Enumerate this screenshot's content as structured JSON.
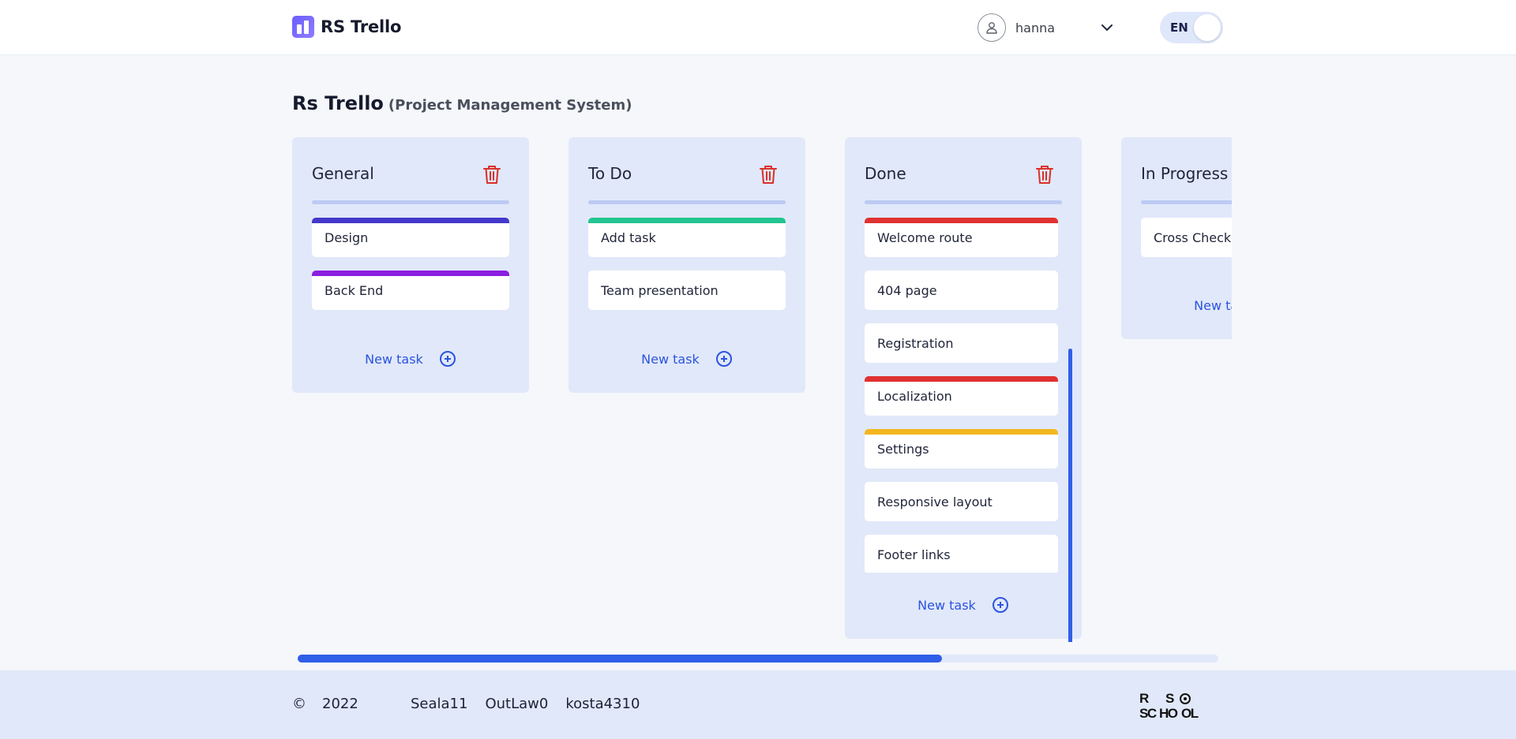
{
  "header": {
    "app_name": "RS Trello",
    "username": "hanna",
    "lang": "EN"
  },
  "page": {
    "title": "Rs Trello",
    "subtitle": "(Project Management System)"
  },
  "columns": [
    {
      "title": "General",
      "tasks": [
        {
          "label": "Design",
          "color": "#4338ca"
        },
        {
          "label": "Back End",
          "color": "#8b1fe0"
        }
      ],
      "new_task_label": "New task"
    },
    {
      "title": "To Do",
      "tasks": [
        {
          "label": "Add task",
          "color": "#22c58f"
        },
        {
          "label": "Team presentation",
          "color": ""
        }
      ],
      "new_task_label": "New task"
    },
    {
      "title": "Done",
      "tasks": [
        {
          "label": "Welcome route",
          "color": "#e03131"
        },
        {
          "label": "404 page",
          "color": ""
        },
        {
          "label": "Registration",
          "color": ""
        },
        {
          "label": "Localization",
          "color": "#e03131"
        },
        {
          "label": "Settings",
          "color": "#f2b71f"
        },
        {
          "label": "Responsive layout",
          "color": ""
        },
        {
          "label": "Footer links",
          "color": ""
        }
      ],
      "new_task_label": "New task"
    },
    {
      "title": "In Progress",
      "tasks": [
        {
          "label": "Cross Check",
          "color": ""
        }
      ],
      "new_task_label": "New task"
    }
  ],
  "board_scroll_progress": 0.7,
  "footer": {
    "copyright_symbol": "©",
    "year": "2022",
    "authors": [
      "Seala11",
      "OutLaw0",
      "kosta4310"
    ],
    "school_logo_text": "RS SCHOOL"
  },
  "colors": {
    "accent": "#2f5ee8",
    "column_bg": "#e1e8f9",
    "delete": "#d9302b"
  }
}
